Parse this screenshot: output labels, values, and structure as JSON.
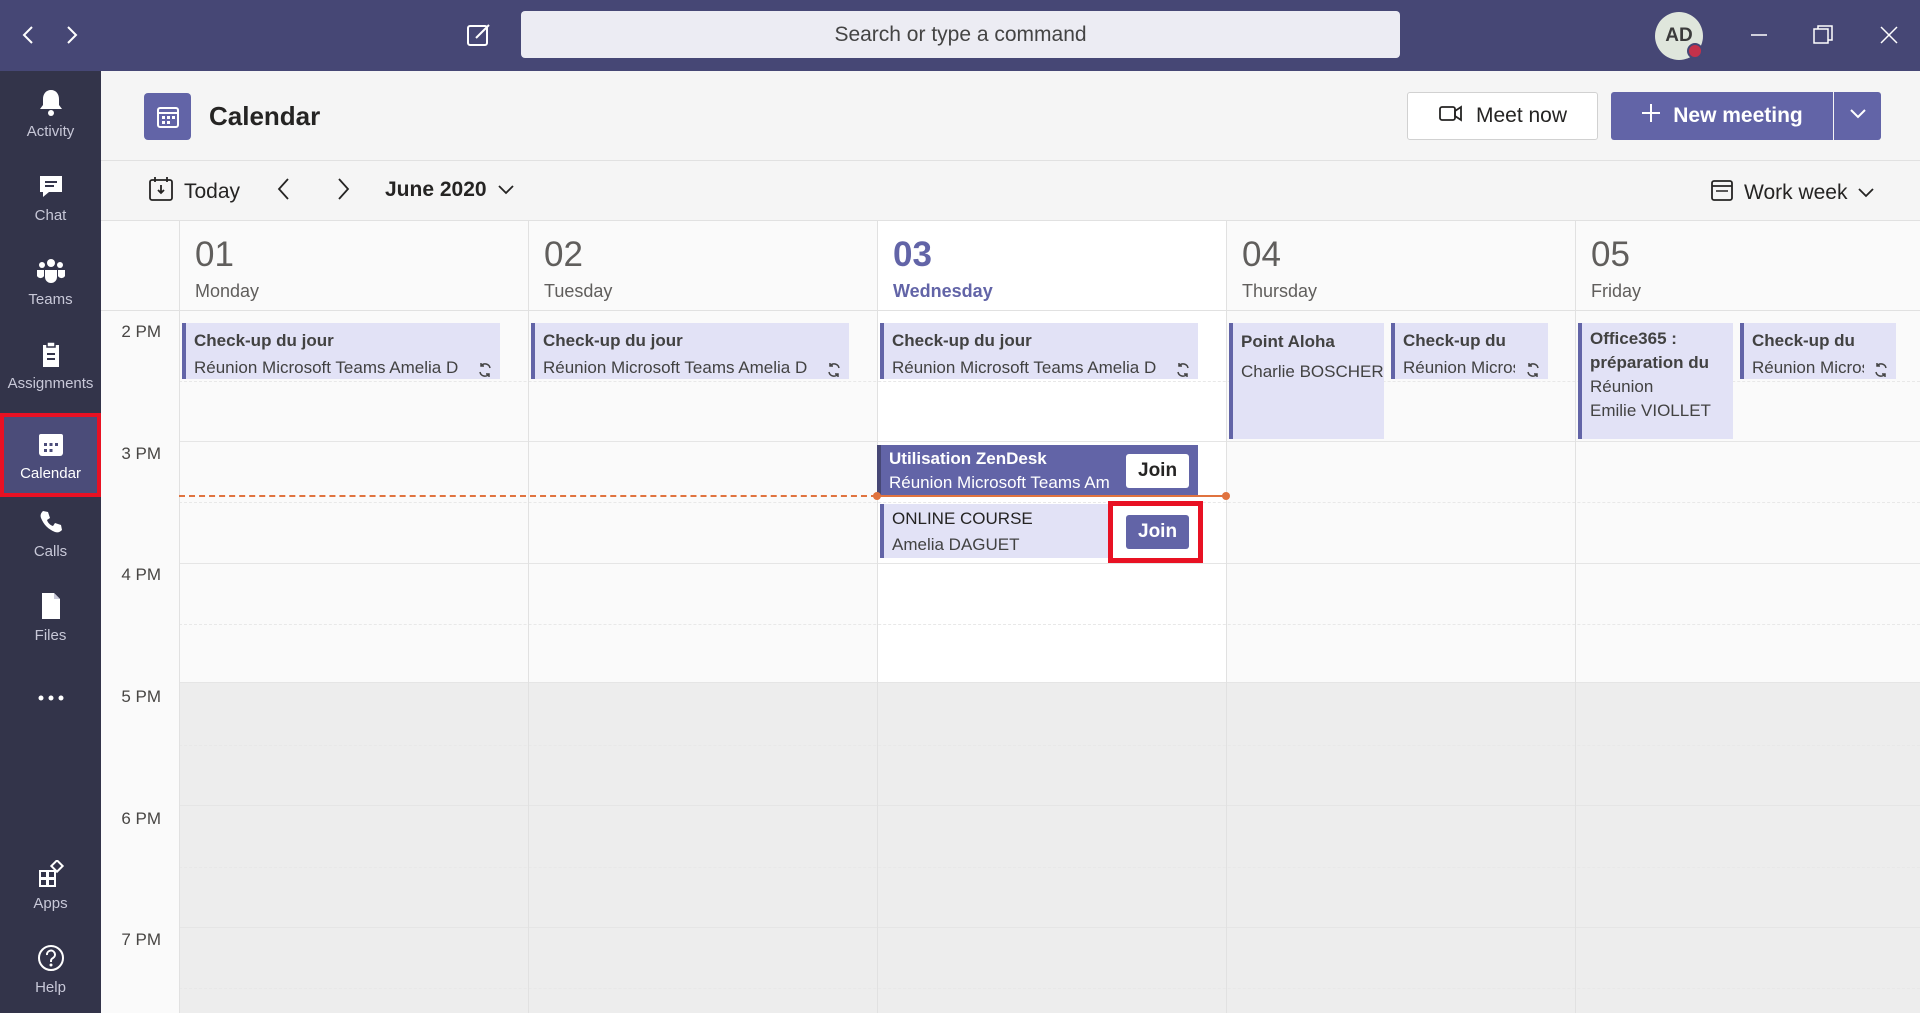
{
  "titlebar": {
    "search_placeholder": "Search or type a command",
    "avatar_initials": "AD"
  },
  "rail": {
    "items": [
      {
        "label": "Activity",
        "icon": "bell-icon"
      },
      {
        "label": "Chat",
        "icon": "chat-icon"
      },
      {
        "label": "Teams",
        "icon": "teams-icon"
      },
      {
        "label": "Assignments",
        "icon": "assignments-icon"
      },
      {
        "label": "Calendar",
        "icon": "calendar-icon",
        "active": true
      },
      {
        "label": "Calls",
        "icon": "phone-icon"
      },
      {
        "label": "Files",
        "icon": "file-icon"
      },
      {
        "label": "Apps",
        "icon": "apps-icon"
      },
      {
        "label": "Help",
        "icon": "help-icon"
      }
    ]
  },
  "header": {
    "title": "Calendar",
    "meet_now": "Meet now",
    "new_meeting": "New meeting"
  },
  "toolbar": {
    "today": "Today",
    "month": "June 2020",
    "view": "Work week"
  },
  "days": [
    {
      "num": "01",
      "name": "Monday"
    },
    {
      "num": "02",
      "name": "Tuesday"
    },
    {
      "num": "03",
      "name": "Wednesday",
      "today": true
    },
    {
      "num": "04",
      "name": "Thursday"
    },
    {
      "num": "05",
      "name": "Friday"
    }
  ],
  "times": [
    "2 PM",
    "3 PM",
    "4 PM",
    "5 PM",
    "6 PM",
    "7 PM"
  ],
  "events": {
    "checkup_title": "Check-up du jour",
    "checkup_sub": "Réunion Microsoft Teams  Amelia D",
    "checkup_short_title": "Check-up du",
    "checkup_short_sub": "Réunion Microsoft",
    "aloha_title": "Point Aloha",
    "aloha_sub": "Charlie BOSCHER",
    "o365_title_1": "Office365 :",
    "o365_title_2": "préparation du",
    "o365_sub": "Réunion",
    "o365_org": "Emilie VIOLLET",
    "zendesk_title": "Utilisation ZenDesk",
    "zendesk_sub": "Réunion Microsoft Teams  Am",
    "course_title": "ONLINE COURSE",
    "course_sub": "Amelia DAGUET",
    "join": "Join"
  },
  "colors": {
    "brand": "#6264a7",
    "titlebar": "#464775",
    "rail": "#33344a",
    "highlight": "#e81123",
    "now_line": "#e0733f"
  }
}
